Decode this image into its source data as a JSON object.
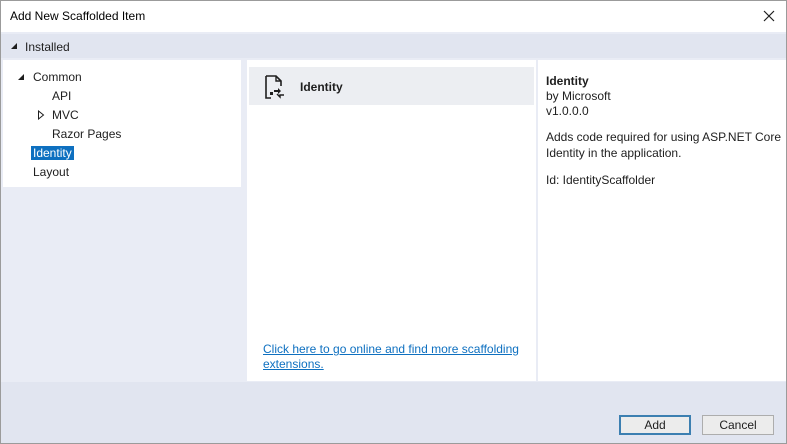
{
  "window": {
    "title": "Add New Scaffolded Item"
  },
  "installed": {
    "label": "Installed"
  },
  "tree": {
    "common": "Common",
    "api": "API",
    "mvc": "MVC",
    "razor_pages": "Razor Pages",
    "identity": "Identity",
    "layout": "Layout"
  },
  "list": {
    "items": [
      {
        "name": "Identity"
      }
    ],
    "online_link": "Click here to go online and find more scaffolding extensions."
  },
  "details": {
    "title": "Identity",
    "author": "by Microsoft",
    "version": "v1.0.0.0",
    "description": "Adds code required for using ASP.NET Core Identity in the application.",
    "id": "Id: IdentityScaffolder"
  },
  "buttons": {
    "add": "Add",
    "cancel": "Cancel"
  }
}
